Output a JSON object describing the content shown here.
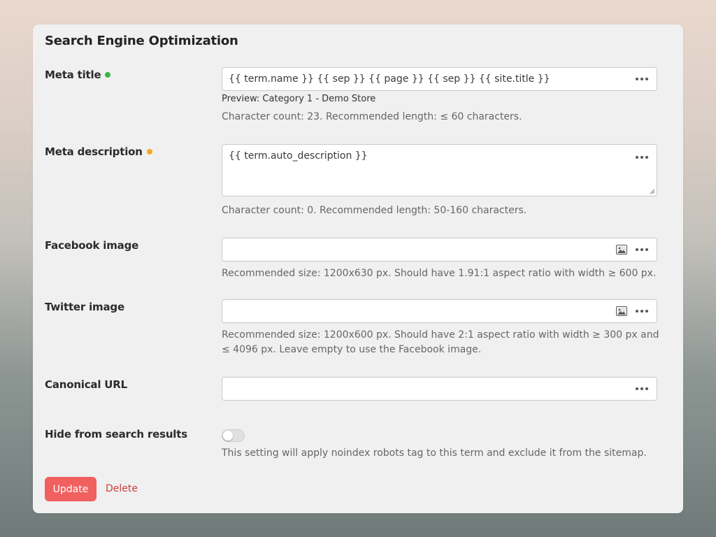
{
  "panel": {
    "title": "Search Engine Optimization"
  },
  "meta_title": {
    "label": "Meta title",
    "status_color": "#3bb54a",
    "value": "{{ term.name }} {{ sep }} {{ page }} {{ sep }} {{ site.title }}",
    "preview": "Preview: Category 1 - Demo Store",
    "help": "Character count: 23. Recommended length: ≤ 60 characters."
  },
  "meta_description": {
    "label": "Meta description",
    "status_color": "#f5a623",
    "value": "{{ term.auto_description }}",
    "help": "Character count: 0. Recommended length: 50-160 characters."
  },
  "facebook_image": {
    "label": "Facebook image",
    "value": "",
    "help": "Recommended size: 1200x630 px. Should have 1.91:1 aspect ratio with width ≥ 600 px."
  },
  "twitter_image": {
    "label": "Twitter image",
    "value": "",
    "help": "Recommended size: 1200x600 px. Should have 2:1 aspect ratio with width ≥ 300 px and ≤ 4096 px. Leave empty to use the Facebook image."
  },
  "canonical_url": {
    "label": "Canonical URL",
    "value": ""
  },
  "hide_from_search": {
    "label": "Hide from search results",
    "enabled": false,
    "help": "This setting will apply noindex robots tag to this term and exclude it from the sitemap."
  },
  "actions": {
    "update_label": "Update",
    "delete_label": "Delete",
    "accent_color": "#f0605e"
  }
}
